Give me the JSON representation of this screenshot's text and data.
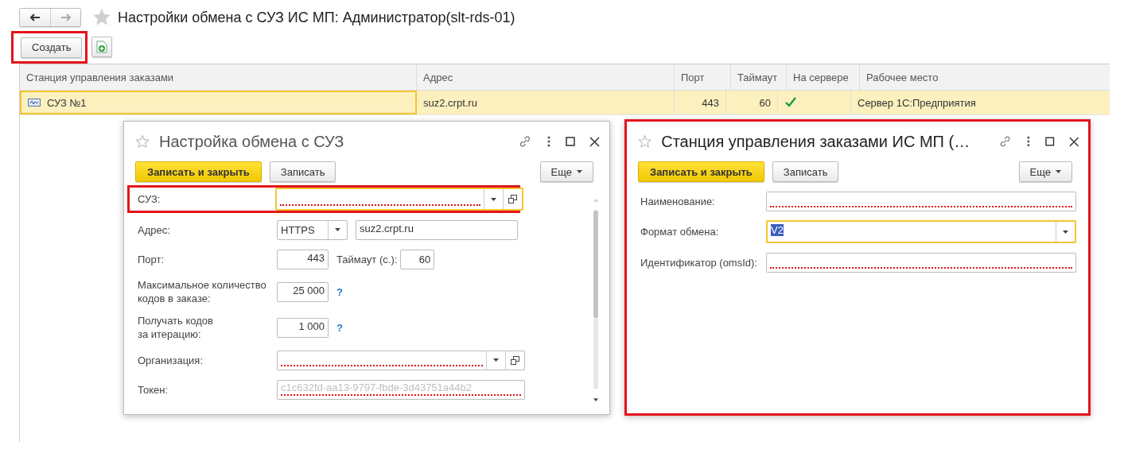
{
  "window": {
    "title": "Настройки обмена с СУЗ ИС МП: Администратор(slt-rds-01)",
    "favorite": false
  },
  "toolbar": {
    "create_button": "Создать",
    "create_highlighted": true
  },
  "table": {
    "columns": [
      "Станция управления заказами",
      "Адрес",
      "Порт",
      "Таймаут",
      "На сервере",
      "Рабочее место"
    ],
    "rows": [
      {
        "name": "СУЗ №1",
        "address": "suz2.crpt.ru",
        "port": "443",
        "timeout": "60",
        "on_server": true,
        "workplace": "Сервер 1С:Предприятия",
        "selected": true
      }
    ]
  },
  "dialogs": [
    {
      "title": "Настройка обмена с СУЗ",
      "highlighted": false,
      "title_dim": true,
      "primary_button": "Записать и закрыть",
      "button": "Записать",
      "more_button": "Еще",
      "scrollbar": true,
      "fields": [
        {
          "kind": "select_open",
          "label": "СУЗ:",
          "required": true,
          "focused": true,
          "highlighted": true
        },
        {
          "kind": "address",
          "label": "Адрес:",
          "protocol": "HTTPS",
          "value": "suz2.crpt.ru",
          "required": false,
          "focused": false,
          "highlighted": false
        },
        {
          "kind": "port",
          "label": "Порт:",
          "value": "443",
          "timeout_label": "Таймаут (с.):",
          "timeout_value": "60",
          "required": false,
          "focused": false,
          "highlighted": false
        },
        {
          "kind": "number_help",
          "label": "Максимальное количество\nкодов в заказе:",
          "value": "25 000",
          "help": "?",
          "required": false,
          "focused": false,
          "highlighted": false
        },
        {
          "kind": "number_help",
          "label": "Получать кодов\nза итерацию:",
          "value": "1 000",
          "help": "?",
          "required": false,
          "focused": false,
          "highlighted": false
        },
        {
          "kind": "select_open",
          "label": "Организация:",
          "required": true,
          "focused": false,
          "highlighted": false
        },
        {
          "kind": "text",
          "label": "Токен:",
          "placeholder": "c1c632fd-aa13-9797-fbde-3d43751a44b2",
          "required": true,
          "focused": false,
          "highlighted": false
        }
      ]
    },
    {
      "title": "Станция управления заказами ИС МП (…",
      "highlighted": true,
      "title_dim": false,
      "primary_button": "Записать и закрыть",
      "button": "Записать",
      "more_button": "Еще",
      "scrollbar": false,
      "fields": [
        {
          "kind": "text",
          "label": "Наименование:",
          "required": true,
          "focused": false,
          "highlighted": false
        },
        {
          "kind": "select",
          "label": "Формат обмена:",
          "value": "V2",
          "value_selected": true,
          "required": false,
          "focused": true,
          "highlighted": false
        },
        {
          "kind": "text",
          "label": "Идентификатор (omsId):",
          "required": true,
          "focused": false,
          "highlighted": false
        }
      ]
    }
  ]
}
